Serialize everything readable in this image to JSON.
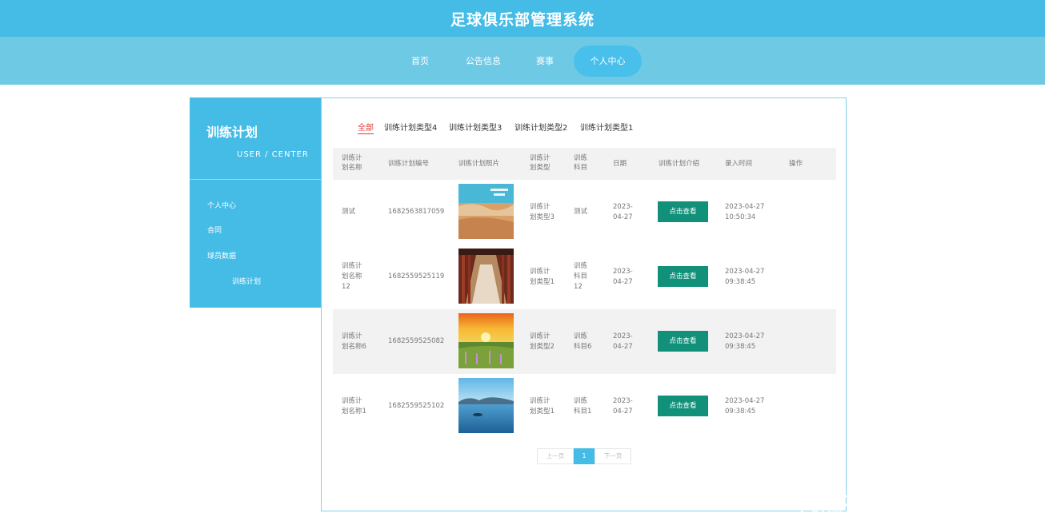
{
  "header": {
    "title": "足球俱乐部管理系统"
  },
  "nav": {
    "items": [
      "首页",
      "公告信息",
      "赛事",
      "个人中心"
    ]
  },
  "sidebar": {
    "title": "训练计划",
    "subtitle": "USER / CENTER",
    "items": [
      "个人中心",
      "合同",
      "球员数据",
      "训练计划"
    ]
  },
  "tabs": [
    "全部",
    "训练计划类型4",
    "训练计划类型3",
    "训练计划类型2",
    "训练计划类型1"
  ],
  "table": {
    "columns": [
      "训练计\n划名称",
      "训练计划编号",
      "训练计划照片",
      "训练计\n划类型",
      "训练\n科目",
      "日期",
      "训练计划介绍",
      "录入时间",
      "操作"
    ],
    "rows": [
      {
        "name": "测试",
        "code": "1682563817059",
        "type": "训练计\n划类型3",
        "subject": "测试",
        "date": "2023-\n04-27",
        "action": "点击查看",
        "time": "2023-04-27\n10:50:34"
      },
      {
        "name": "训练计\n划名称\n12",
        "code": "1682559525119",
        "type": "训练计\n划类型1",
        "subject": "训练\n科目\n12",
        "date": "2023-\n04-27",
        "action": "点击查看",
        "time": "2023-04-27\n09:38:45"
      },
      {
        "name": "训练计\n划名称6",
        "code": "1682559525082",
        "type": "训练计\n划类型2",
        "subject": "训练\n科目6",
        "date": "2023-\n04-27",
        "action": "点击查看",
        "time": "2023-04-27\n09:38:45"
      },
      {
        "name": "训练计\n划名称1",
        "code": "1682559525102",
        "type": "训练计\n划类型1",
        "subject": "训练\n科目1",
        "date": "2023-\n04-27",
        "action": "点击查看",
        "time": "2023-04-27\n09:38:45"
      }
    ]
  },
  "pagination": {
    "prev": "上一页",
    "current": "1",
    "next": "下一页"
  },
  "watermark": {
    "line1": "掘金技术社区 @ 小飞计算机毕设",
    "line2": "CSDN @计算机毕业论文辅导"
  },
  "colors": {
    "header": "#45bce6",
    "nav": "#6ec9e5",
    "accent_button": "#11907a",
    "active_tab": "#e53935"
  }
}
